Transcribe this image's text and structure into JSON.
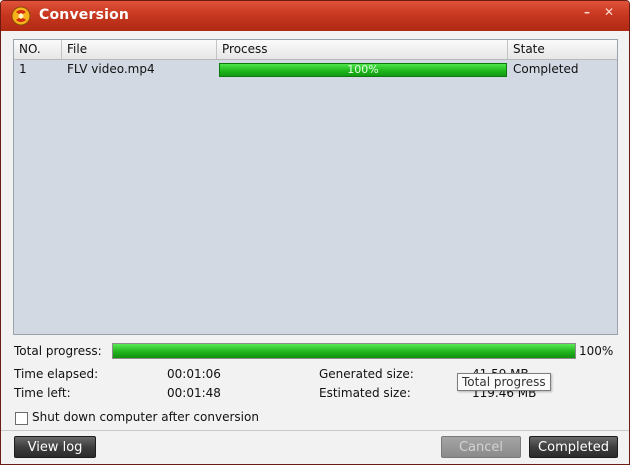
{
  "window": {
    "title": "Conversion",
    "minimize_glyph": "–",
    "close_glyph": "✕"
  },
  "table": {
    "columns": [
      "NO.",
      "File",
      "Process",
      "State"
    ],
    "rows": [
      {
        "no": "1",
        "file": "FLV video.mp4",
        "progress_text": "100%",
        "progress": 1.0,
        "state": "Completed"
      }
    ]
  },
  "stats": {
    "total_progress_label": "Total progress:",
    "total_progress_value": "100%",
    "total_progress": 1.0,
    "time_elapsed_label": "Time elapsed:",
    "time_elapsed": "00:01:06",
    "time_left_label": "Time left:",
    "time_left": "00:01:48",
    "generated_size_label": "Generated size:",
    "generated_size": "41.59 MB",
    "estimated_size_label": "Estimated size:",
    "estimated_size": "119.46 MB"
  },
  "tooltip": "Total progress",
  "shutdown_checkbox": {
    "label": "Shut down computer after conversion",
    "checked": false
  },
  "buttons": {
    "view_log": "View log",
    "cancel": "Cancel",
    "completed": "Completed"
  },
  "colors": {
    "titlebar": "#c8371f",
    "progress": "#21b51e",
    "grid_bg": "#d2d9e3"
  },
  "icons": {
    "app": "app-logo-icon",
    "minimize": "minimize-icon",
    "close": "close-icon"
  }
}
